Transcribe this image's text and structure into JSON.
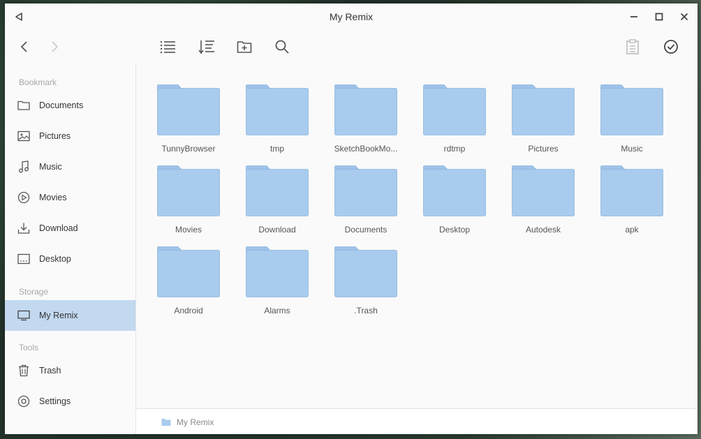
{
  "window": {
    "title": "My Remix"
  },
  "sidebar": {
    "sections": {
      "bookmark": "Bookmark",
      "storage": "Storage",
      "tools": "Tools"
    },
    "bookmarks": [
      {
        "label": "Documents",
        "icon": "folder-icon"
      },
      {
        "label": "Pictures",
        "icon": "image-icon"
      },
      {
        "label": "Music",
        "icon": "music-note-icon"
      },
      {
        "label": "Movies",
        "icon": "play-circle-icon"
      },
      {
        "label": "Download",
        "icon": "download-icon"
      },
      {
        "label": "Desktop",
        "icon": "desktop-icon"
      }
    ],
    "storage": [
      {
        "label": "My Remix",
        "icon": "monitor-icon",
        "active": true
      }
    ],
    "tools": [
      {
        "label": "Trash",
        "icon": "trash-icon"
      },
      {
        "label": "Settings",
        "icon": "settings-icon"
      }
    ]
  },
  "folders": [
    "TunnyBrowser",
    "tmp",
    "SketchBookMo...",
    "rdtmp",
    "Pictures",
    "Music",
    "Movies",
    "Download",
    "Documents",
    "Desktop",
    "Autodesk",
    "apk",
    "Android",
    "Alarms",
    ".Trash"
  ],
  "statusbar": {
    "path": "My Remix"
  },
  "colors": {
    "folder_fill": "#a8cbee",
    "folder_tab": "#9ec3ea",
    "folder_stroke": "#8db5dd",
    "active_bg": "#c3d9f0",
    "icon": "#555555"
  }
}
